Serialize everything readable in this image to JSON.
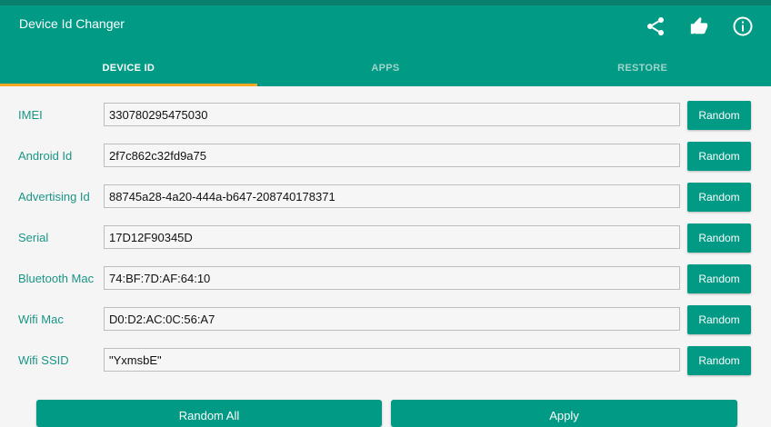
{
  "app": {
    "title": "Device Id Changer",
    "accent_color": "#009a85",
    "indicator_color": "#f5a623",
    "label_color": "#1a9585",
    "actions": [
      {
        "icon": "share-icon"
      },
      {
        "icon": "thumbs-up-icon"
      },
      {
        "icon": "info-icon"
      }
    ]
  },
  "tabs": [
    {
      "label": "DEVICE ID",
      "active": true
    },
    {
      "label": "APPS",
      "active": false
    },
    {
      "label": "RESTORE",
      "active": false
    }
  ],
  "fields": [
    {
      "label": "IMEI",
      "value": "330780295475030",
      "button": "Random"
    },
    {
      "label": "Android Id",
      "value": "2f7c862c32fd9a75",
      "button": "Random"
    },
    {
      "label": "Advertising Id",
      "value": "88745a28-4a20-444a-b647-208740178371",
      "button": "Random"
    },
    {
      "label": "Serial",
      "value": "17D12F90345D",
      "button": "Random"
    },
    {
      "label": "Bluetooth Mac",
      "value": "74:BF:7D:AF:64:10",
      "button": "Random"
    },
    {
      "label": "Wifi Mac",
      "value": "D0:D2:AC:0C:56:A7",
      "button": "Random"
    },
    {
      "label": "Wifi SSID",
      "value": "\"YxmsbE\"",
      "button": "Random"
    }
  ],
  "footer": {
    "random_all_label": "Random All",
    "apply_label": "Apply"
  }
}
